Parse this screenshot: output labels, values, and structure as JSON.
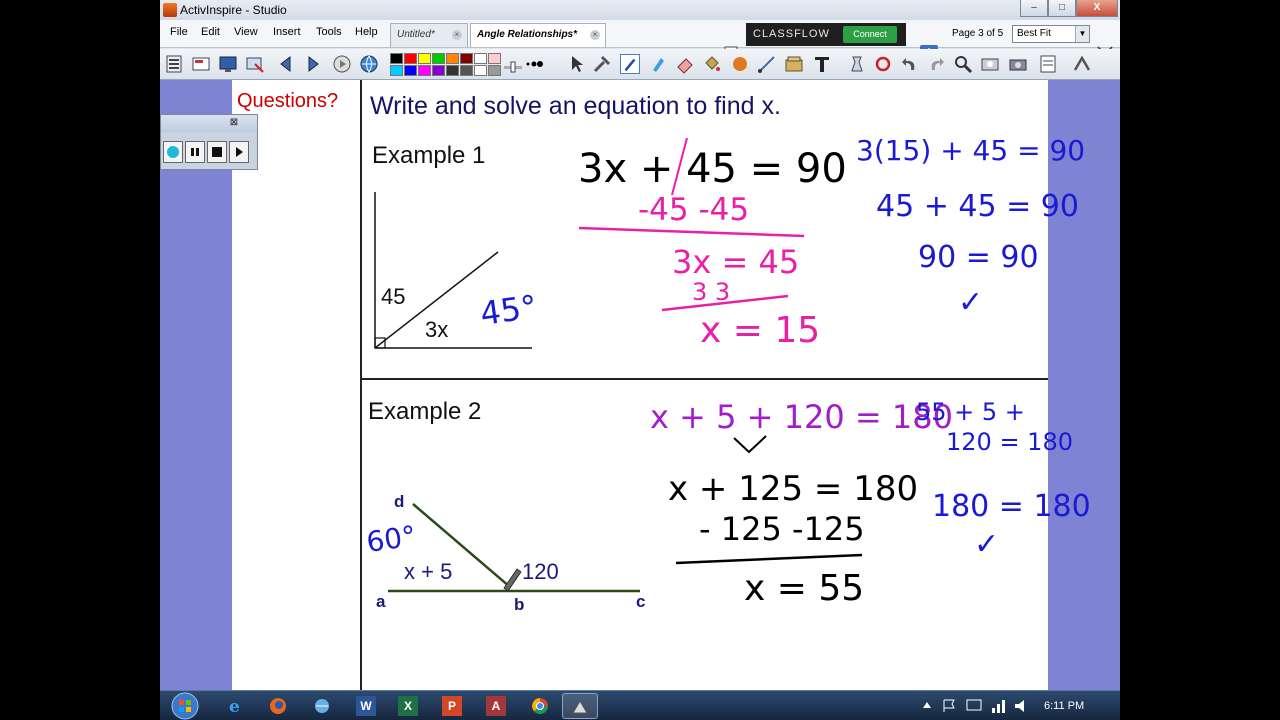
{
  "window": {
    "title": "ActivInspire - Studio",
    "controls": {
      "minimize": "–",
      "maximize": "□",
      "close": "X"
    }
  },
  "menu": {
    "items": [
      "File",
      "Edit",
      "View",
      "Insert",
      "Tools",
      "Help"
    ]
  },
  "tabs": [
    {
      "label": "Untitled*",
      "active": false
    },
    {
      "label": "Angle Relationships*",
      "active": true
    }
  ],
  "classflow": {
    "brand": "CLASSFLOW",
    "button": "Connect"
  },
  "pager": {
    "indicator": "Page 3 of 5",
    "zoom": "Best Fit"
  },
  "palette": {
    "row1": [
      "#000000",
      "#ff0000",
      "#ffff00",
      "#00cc00",
      "#ff8800",
      "#800000",
      "#ffffff",
      "#ffcccc"
    ],
    "row2": [
      "#00ccff",
      "#0000ff",
      "#ff00ff",
      "#8800cc",
      "#333333",
      "#555555",
      "#ffffff",
      "#999999"
    ]
  },
  "flipchart": {
    "questions": "Questions?",
    "heading": "Write and solve an equation to find x.",
    "example1": {
      "label": "Example 1",
      "angle_label_a": "45",
      "angle_label_b": "3x",
      "annotation": "45°",
      "work": {
        "line1": "3x + 45 = 90",
        "line2": "-45  -45",
        "line3": "3x = 45",
        "line4": "3      3",
        "line5": "x = 15"
      },
      "check": {
        "line1": "3(15) + 45 = 90",
        "line2": "45 + 45 = 90",
        "line3": "90 = 90",
        "mark": "✓"
      }
    },
    "example2": {
      "label": "Example 2",
      "point_a": "a",
      "point_b": "b",
      "point_c": "c",
      "point_d": "d",
      "angle_label_1": "x + 5",
      "angle_label_2": "120",
      "annotation": "60°",
      "work": {
        "line1": "x + 5 + 120 = 180",
        "line2": "x + 125 = 180",
        "line3": "- 125  -125",
        "line4": "x = 55"
      },
      "check": {
        "line1": "55 + 5 +",
        "line2": "120 = 180",
        "line3": "180 = 180",
        "mark": "✓"
      }
    }
  },
  "taskbar": {
    "apps": [
      "ie-icon",
      "firefox-icon",
      "network-icon",
      "word-icon",
      "excel-icon",
      "powerpoint-icon",
      "access-icon",
      "chrome-icon",
      "activinspire-icon"
    ],
    "word_letter": "W",
    "excel_letter": "X",
    "powerpoint_letter": "P",
    "access_letter": "A",
    "clock": "6:11 PM"
  }
}
